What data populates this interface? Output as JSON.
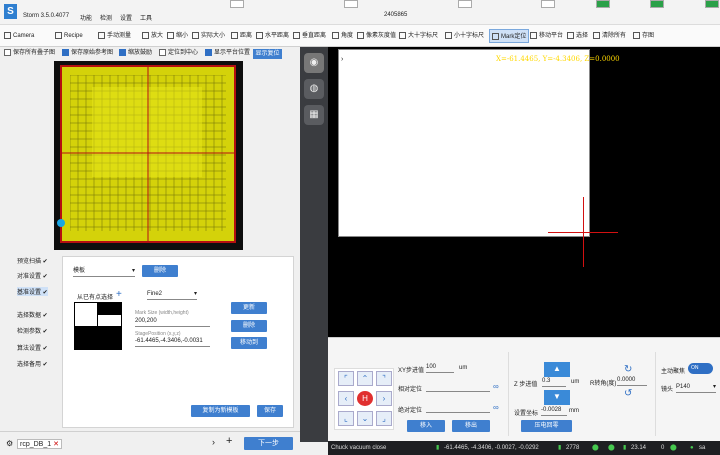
{
  "app": {
    "title": "Storm 3.5.0.4077",
    "menu": [
      "功能",
      "检测",
      "设置",
      "工具"
    ],
    "window_id": "2405865"
  },
  "toolbar": {
    "camera_label": "Camera",
    "recipe_label": "Recipe",
    "items": [
      "手动测量",
      "放大",
      "缩小",
      "实际大小",
      "距离",
      "水平距离",
      "垂直距离",
      "角度",
      "像素灰度值",
      "大十字标尺",
      "小十字标尺",
      "Mark定位",
      "移动平台",
      "选择",
      "清除所有",
      "存图"
    ]
  },
  "view_options": {
    "items": [
      {
        "label": "保存所有叠子图",
        "checked": false
      },
      {
        "label": "保存原始参考图",
        "checked": true
      },
      {
        "label": "缩放鼓励",
        "checked": true
      },
      {
        "label": "定位到中心",
        "checked": false
      },
      {
        "label": "显示平台位置",
        "checked": true
      }
    ],
    "show_position_button": "显示复位"
  },
  "steps": [
    "预览扫描",
    "对准设置",
    "基准设置",
    "选择数据",
    "检测参数",
    "算法设置",
    "选择备用"
  ],
  "recipe": {
    "template_combo": "模板",
    "delete_label": "删除",
    "select_from_existing": "从已有点选择",
    "fine_combo": "Fine2",
    "update_label": "更新",
    "delete2_label": "删除",
    "move_to_label": "移动到",
    "mark_size_label": "Mark Size (width,height)",
    "mark_size_value": "200,200",
    "stage_position_label": "StagePosition (x,y,z)",
    "stage_position_value": "-61.4465,-4.3406,-0.0031",
    "copy_template_label": "复制为新模板",
    "save_label": "保存"
  },
  "bottom": {
    "tab_label": "rcp_DB_1",
    "next_step_label": "下一步"
  },
  "camera_view": {
    "coord_text": "X=-61.4465, Y=-4.3406, Z=0.0000"
  },
  "control": {
    "xy_step_label": "XY步进值",
    "xy_step_value": "100",
    "xy_step_unit": "um",
    "relative_pos_label": "相对定位",
    "absolute_pos_label": "绝对定位",
    "move_in_label": "移入",
    "move_out_label": "移出",
    "z_step_label": "Z 步进值",
    "z_step_value": "0.3",
    "z_step_unit": "um",
    "r_rotate_label": "R转角(度)",
    "r_rotate_value": "0.0000",
    "setting_coord_label": "设置坐标",
    "setting_coord_value": "-0.0028",
    "setting_coord_unit": "mm",
    "lift_home_label": "压电回零",
    "autofocus_label": "主动聚焦",
    "autofocus_state": "ON",
    "lens_label": "镜头",
    "lens_value": "P140",
    "home_label": "H"
  },
  "status": {
    "message": "Chuck vacuum close",
    "position": "-61.4465, -4.3406, -0.0027, -0.0292",
    "count": "2778",
    "temperature": "23.14",
    "counter2": "0",
    "user": "sa"
  }
}
